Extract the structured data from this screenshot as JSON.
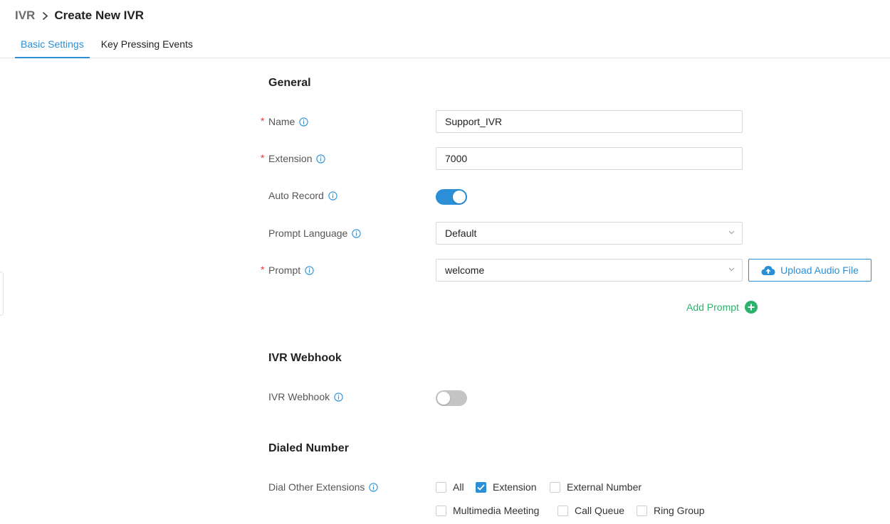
{
  "breadcrumb": {
    "parent": "IVR",
    "current": "Create New IVR"
  },
  "tabs": [
    {
      "label": "Basic Settings",
      "active": true
    },
    {
      "label": "Key Pressing Events",
      "active": false
    }
  ],
  "sections": {
    "general": "General",
    "webhook": "IVR Webhook",
    "dialed": "Dialed Number"
  },
  "fields": {
    "name": {
      "label": "Name",
      "value": "Support_IVR",
      "required": true
    },
    "extension": {
      "label": "Extension",
      "value": "7000",
      "required": true
    },
    "auto_record": {
      "label": "Auto Record",
      "enabled": true
    },
    "prompt_language": {
      "label": "Prompt Language",
      "value": "Default"
    },
    "prompt": {
      "label": "Prompt",
      "value": "welcome",
      "required": true
    },
    "ivr_webhook": {
      "label": "IVR Webhook",
      "enabled": false
    },
    "dial_other": {
      "label": "Dial Other Extensions"
    }
  },
  "buttons": {
    "upload": "Upload Audio File",
    "add_prompt": "Add Prompt"
  },
  "checkboxes": [
    {
      "label": "All",
      "checked": false
    },
    {
      "label": "Extension",
      "checked": true
    },
    {
      "label": "External Number",
      "checked": false
    },
    {
      "label": "Multimedia Meeting",
      "checked": false
    },
    {
      "label": "Call Queue",
      "checked": false
    },
    {
      "label": "Ring Group",
      "checked": false
    }
  ],
  "colors": {
    "accent": "#2a8fd7",
    "success": "#2cb36a",
    "required": "#e03a3a"
  }
}
